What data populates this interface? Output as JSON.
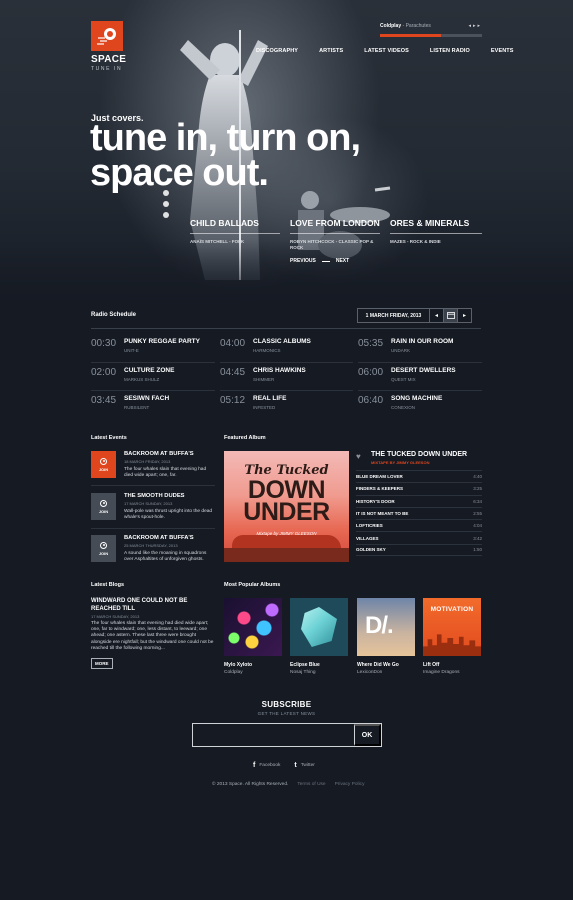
{
  "brand": {
    "name": "SPACE",
    "tagline": "TUNE IN",
    "accent": "#e0461e"
  },
  "player": {
    "artist": "Coldplay",
    "separator": " - ",
    "song": "Parachutes",
    "progress": 0.6
  },
  "nav": [
    "DISCOGRAPHY",
    "ARTISTS",
    "LATEST VIDEOS",
    "LISTEN RADIO",
    "EVENTS"
  ],
  "hero": {
    "kicker": "Just covers.",
    "headline_line1": "tune in, turn on,",
    "headline_line2": "space out.",
    "slides": [
      {
        "title": "CHILD BALLADS",
        "sub": "ANAÏS MITCHELL - FOLK"
      },
      {
        "title": "LOVE FROM LONDON",
        "sub": "ROBYN HITCHCOCK - CLASSIC POP & ROCK"
      },
      {
        "title": "ORES & MINERALS",
        "sub": "MAZES - ROCK & INDIE"
      }
    ],
    "prev": "PREVIOUS",
    "next": "NEXT"
  },
  "radio": {
    "title": "Radio Schedule",
    "date": "1 MARCH FRIDAY, 2013",
    "columns": [
      [
        {
          "time": "00:30",
          "show": "PUNKY REGGAE PARTY",
          "host": "UNIT-E"
        },
        {
          "time": "02:00",
          "show": "CULTURE ZONE",
          "host": "MARKUS SHULZ"
        },
        {
          "time": "03:45",
          "show": "SESIWN FACH",
          "host": "RUBSILENT"
        }
      ],
      [
        {
          "time": "04:00",
          "show": "CLASSIC ALBUMS",
          "host": "HARMONICS"
        },
        {
          "time": "04:45",
          "show": "CHRIS HAWKINS",
          "host": "SHIMMER"
        },
        {
          "time": "05:12",
          "show": "REAL LIFE",
          "host": "INFESTED"
        }
      ],
      [
        {
          "time": "05:35",
          "show": "RAIN IN OUR ROOM",
          "host": "UNDARK"
        },
        {
          "time": "06:00",
          "show": "DESERT DWELLERS",
          "host": "QUEST MIX"
        },
        {
          "time": "06:40",
          "show": "SONG MACHINE",
          "host": "CONEXION"
        }
      ]
    ]
  },
  "events": {
    "title": "Latest Events",
    "join_label": "JOIN",
    "items": [
      {
        "title": "BACKROOM AT BUFFA'S",
        "date": "18 MARCH FRIDAY, 2013",
        "text": "The four whales slain that evening had died wide apart; one, far."
      },
      {
        "title": "THE SMOOTH DUDES",
        "date": "17 MARCH SUNDAY, 2013",
        "text": "Wall-pole was thrust upright into the dead whale's spout-hole."
      },
      {
        "title": "BACKROOM AT BUFFA'S",
        "date": "25 MARCH THURSDAY, 2013",
        "text": "A sound like the moaning in squadrons over Asphaltites of unforgiven ghosts."
      }
    ]
  },
  "featured": {
    "title": "Featured Album",
    "cover_the": "The Tucked",
    "cover_big1": "DOWN",
    "cover_big2": "UNDER",
    "cover_sub": "Mixtape by JIMMY GLEESON",
    "album": "THE TUCKED DOWN UNDER",
    "sub": "MIXTAPE BY JIMMY GLEESON",
    "tracks": [
      {
        "name": "BLUE DREAM LOVER",
        "dur": "4:40"
      },
      {
        "name": "FINDERS & KEEPERS",
        "dur": "3:25"
      },
      {
        "name": "HISTORY'S DOOR",
        "dur": "6:34"
      },
      {
        "name": "IT IS NOT MEANT TO BE",
        "dur": "2:55"
      },
      {
        "name": "LOFTICRIES",
        "dur": "4:04"
      },
      {
        "name": "VILLAGES",
        "dur": "3:42"
      },
      {
        "name": "GOLDEN SKY",
        "dur": "1:50"
      }
    ]
  },
  "blogs": {
    "title": "Latest Blogs",
    "post_title": "WINDWARD ONE COULD NOT BE REACHED TILL",
    "date": "17 MARCH SUNDAY, 2013",
    "text": "The four whales slain that evening had died wide apart; one, far to windward; one, less distant, to leeward; one ahead; one astern. These last three were brought alongside ere nightfall; but the windward one could not be reached till the following morning...",
    "more": "MORE"
  },
  "popular": {
    "title": "Most Popular Albums",
    "items": [
      {
        "name": "Mylo Xyloto",
        "artist": "Coldplay"
      },
      {
        "name": "Eclipse Blue",
        "artist": "Nosaj Thing"
      },
      {
        "name": "Where Did We Go",
        "artist": "LexiconDon",
        "cover_text": "D/."
      },
      {
        "name": "Lift Off",
        "artist": "Imagine Dragons",
        "cover_text": "MOTIVATION"
      }
    ]
  },
  "subscribe": {
    "title": "SUBSCRIBE",
    "sub": "GET THE LATEST NEWS",
    "placeholder": "",
    "button": "OK"
  },
  "social": [
    {
      "icon": "facebook-icon",
      "glyph": "f",
      "label": "Facebook"
    },
    {
      "icon": "twitter-icon",
      "glyph": "t",
      "label": "Twitter"
    }
  ],
  "footer": {
    "copyright": "© 2013 Space. All Rights Reserved.",
    "terms": "Terms of Use",
    "privacy": "Privacy Policy"
  }
}
